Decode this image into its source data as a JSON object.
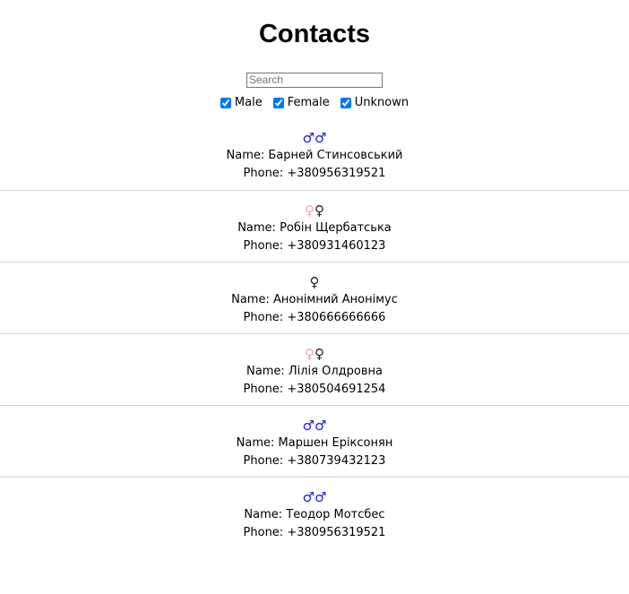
{
  "page": {
    "title": "Contacts"
  },
  "search": {
    "placeholder": "Search",
    "value": ""
  },
  "filters": [
    {
      "label": "Male",
      "checked": true
    },
    {
      "label": "Female",
      "checked": true
    },
    {
      "label": "Unknown",
      "checked": true
    }
  ],
  "contacts": [
    {
      "gender": "male",
      "name_line": "Name: Барней Стинсовський",
      "phone_line": "Phone: +380956319521"
    },
    {
      "gender": "female",
      "name_line": "Name: Робін Щербатська",
      "phone_line": "Phone: +380931460123"
    },
    {
      "gender": "unknown",
      "name_line": "Name: Анонімний Анонімус",
      "phone_line": "Phone: +380666666666"
    },
    {
      "gender": "female",
      "name_line": "Name: Лілія Олдровна",
      "phone_line": "Phone: +380504691254"
    },
    {
      "gender": "male",
      "name_line": "Name: Маршен Еріксонян",
      "phone_line": "Phone: +380739432123"
    },
    {
      "gender": "male",
      "name_line": "Name: Теодор Мотсбес",
      "phone_line": "Phone: +380956319521"
    }
  ],
  "colors": {
    "male_icon": "#1b1bd8",
    "female_icon": "#f2a7b0",
    "checkbox_accent": "#0075ff",
    "divider": "#d3d3d3"
  }
}
